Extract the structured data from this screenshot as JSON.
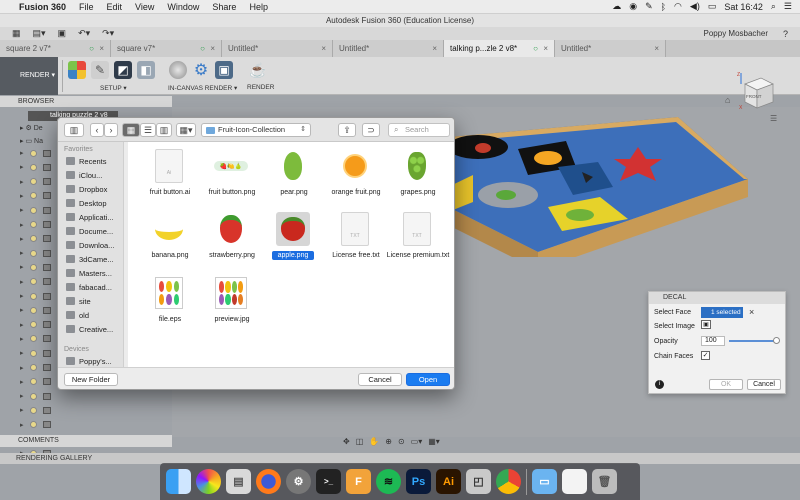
{
  "menubar": {
    "apple": "",
    "app": "Fusion 360",
    "items": [
      "File",
      "Edit",
      "View",
      "Window",
      "Share",
      "Help"
    ],
    "clock": "Sat 16:42"
  },
  "window": {
    "title": "Autodesk Fusion 360 (Education License)"
  },
  "quickbar": {
    "user": "Poppy Mosbacher",
    "help": "?"
  },
  "tabs": [
    {
      "label": "square 2 v7*"
    },
    {
      "label": "square v7*"
    },
    {
      "label": "Untitled*"
    },
    {
      "label": "Untitled*"
    },
    {
      "label": "talking p...zle 2 v8*"
    },
    {
      "label": "Untitled*"
    }
  ],
  "toolbar": {
    "workspace": "RENDER",
    "setup": "SETUP",
    "in_canvas_render": "IN-CANVAS RENDER",
    "render": "RENDER"
  },
  "browser": {
    "header": "BROWSER",
    "root": "talking puzzle 2 v8",
    "item1": "De",
    "item2": "Na"
  },
  "comments": "COMMENTS",
  "rendering_gallery": "RENDERING GALLERY",
  "dialog": {
    "folder": "Fruit-Icon-Collection",
    "search_placeholder": "Search",
    "favorites_header": "Favorites",
    "favorites": [
      "Recents",
      "iClou...",
      "Dropbox",
      "Desktop",
      "Applicati...",
      "Docume...",
      "Downloa...",
      "3dCame...",
      "Masters...",
      "fabacad...",
      "site",
      "old",
      "Creative..."
    ],
    "devices_header": "Devices",
    "devices": [
      "Poppy's..."
    ],
    "files": [
      {
        "name": "fruit button.ai"
      },
      {
        "name": "fruit button.png"
      },
      {
        "name": "pear.png"
      },
      {
        "name": "orange fruit.png"
      },
      {
        "name": "grapes.png"
      },
      {
        "name": "banana.png"
      },
      {
        "name": "strawberry.png"
      },
      {
        "name": "apple.png",
        "selected": true
      },
      {
        "name": "License free.txt"
      },
      {
        "name": "License premium.txt"
      },
      {
        "name": "file.eps"
      },
      {
        "name": "preview.jpg"
      }
    ],
    "new_folder": "New Folder",
    "cancel": "Cancel",
    "open": "Open",
    "file_ext_ai": "Ai",
    "file_ext_txt": "TXT"
  },
  "decal": {
    "title": "DECAL",
    "select_face_label": "Select Face",
    "select_face_value": "1 selected",
    "select_image_label": "Select Image",
    "opacity_label": "Opacity",
    "opacity_value": "100",
    "chain_faces_label": "Chain Faces",
    "ok": "OK",
    "cancel": "Cancel"
  },
  "viewcube": {
    "front": "FRONT",
    "z": "Z",
    "x": "X"
  },
  "colors": {
    "accent_blue": "#1b7cf0",
    "selection_blue": "#1b6de0",
    "board_wood": "#c89a55",
    "board_blue": "#3b6fb8"
  },
  "dock": {
    "apps": [
      "finder",
      "photos",
      "preview",
      "firefox",
      "system-preferences",
      "terminal",
      "fusion-360",
      "spotify",
      "photoshop",
      "illustrator",
      "scrivener",
      "chrome",
      "applications-folder",
      "document",
      "trash"
    ]
  }
}
